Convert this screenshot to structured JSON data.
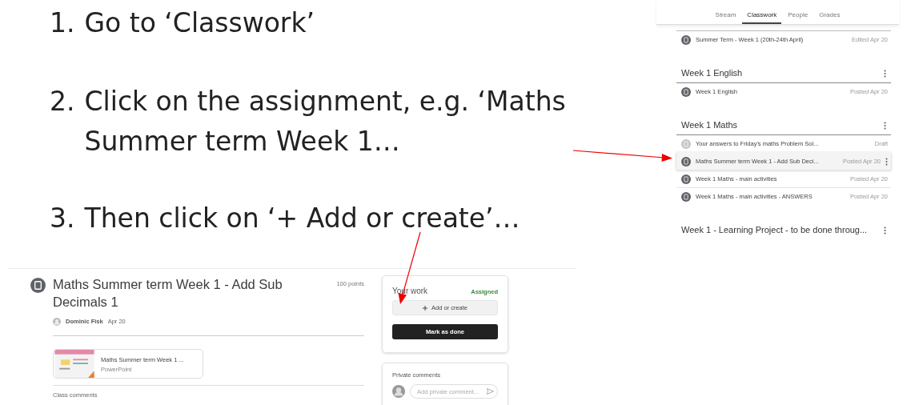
{
  "steps": [
    {
      "number": "1.",
      "text": "Go to ‘Classwork’"
    },
    {
      "number": "2.",
      "text": "Click on the assignment, e.g. ‘Maths Summer term Week 1…"
    },
    {
      "number": "3.",
      "text": "Then click on ‘+ Add or create’…"
    }
  ],
  "classroom": {
    "tabs": [
      {
        "label": "Stream",
        "selected": false
      },
      {
        "label": "Classwork",
        "selected": true
      },
      {
        "label": "People",
        "selected": false
      },
      {
        "label": "Grades",
        "selected": false
      }
    ],
    "rows": [
      {
        "kind": "assignment",
        "title": "Summer Term - Week 1 (20th-24th April)",
        "date": "Edited Apr 20",
        "selected": false,
        "muted": false
      },
      {
        "kind": "topic",
        "title": "Week 1 English"
      },
      {
        "kind": "assignment",
        "title": "Week 1 English",
        "date": "Posted Apr 20",
        "selected": false,
        "muted": false
      },
      {
        "kind": "topic",
        "title": "Week 1 Maths"
      },
      {
        "kind": "assignment",
        "title": "Your answers to Friday's maths Problem Sol...",
        "date": "Draft",
        "selected": false,
        "muted": true
      },
      {
        "kind": "assignment",
        "title": "Maths Summer term Week 1 - Add Sub Deci...",
        "date": "Posted Apr 20",
        "selected": true,
        "muted": false
      },
      {
        "kind": "assignment",
        "title": "Week 1 Maths - main activities",
        "date": "Posted Apr 20",
        "selected": false,
        "muted": false
      },
      {
        "kind": "assignment",
        "title": "Week 1 Maths - main activities - ANSWERS",
        "date": "Posted Apr 20",
        "selected": false,
        "muted": false
      },
      {
        "kind": "topic",
        "title": "Week 1 - Learning Project - to be done throug..."
      }
    ]
  },
  "assignment": {
    "title": "Maths Summer term Week 1 - Add Sub Decimals 1",
    "points": "100 points",
    "author": "Dominic Fisk",
    "date": "Apr 20",
    "attachment": {
      "title": "Maths Summer term Week 1 ...",
      "type": "PowerPoint"
    },
    "class_comments": "Class comments",
    "your_work": {
      "heading": "Your work",
      "status": "Assigned",
      "add_button": "Add or create",
      "done_button": "Mark as done"
    },
    "private_comments": {
      "heading": "Private comments",
      "placeholder": "Add private comment..."
    }
  }
}
